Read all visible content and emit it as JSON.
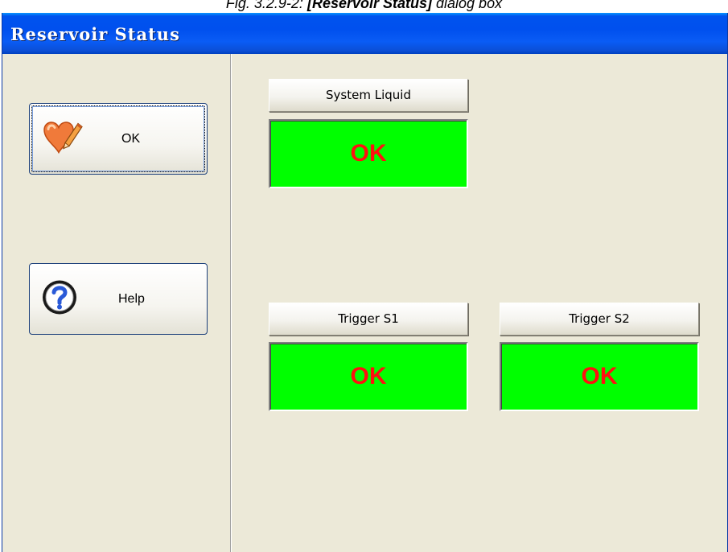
{
  "caption": {
    "prefix": "Fig. 3.2.9-2: ",
    "bold": "[Reservoir Status]",
    "suffix": " dialog box"
  },
  "window": {
    "title": "Reservoir Status"
  },
  "buttons": {
    "ok": {
      "label": "OK",
      "icon": "heart-pencil-icon"
    },
    "help": {
      "label": "Help",
      "icon": "help-icon"
    }
  },
  "status": {
    "system_liquid": {
      "label": "System Liquid",
      "value": "OK"
    },
    "trigger_s1": {
      "label": "Trigger S1",
      "value": "OK"
    },
    "trigger_s2": {
      "label": "Trigger S2",
      "value": "OK"
    }
  },
  "colors": {
    "status_ok_bg": "#00ff00",
    "status_ok_text": "#ff1010",
    "titlebar": "#0053ee",
    "dialog_bg": "#ece9d8"
  }
}
